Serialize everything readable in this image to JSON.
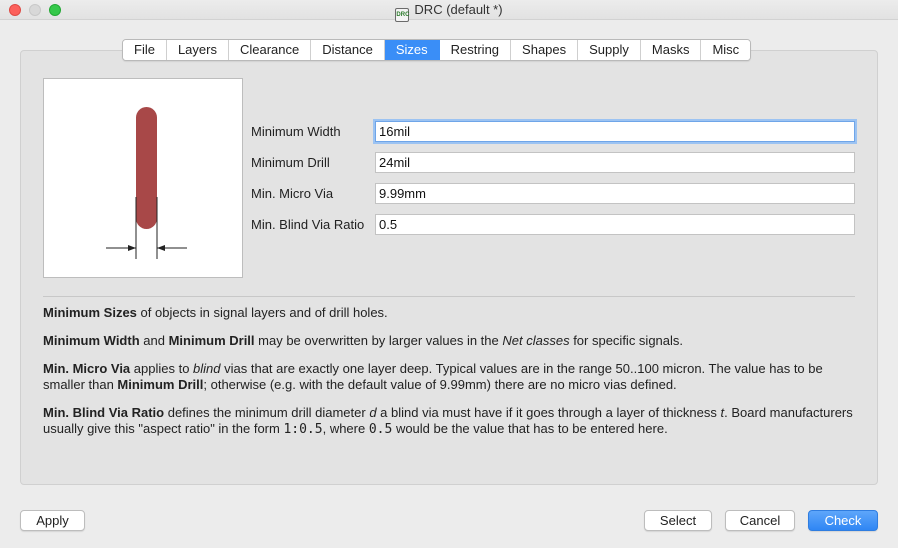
{
  "window": {
    "title": "DRC (default *)",
    "app_icon_text": "DRC"
  },
  "tabs": [
    {
      "label": "File"
    },
    {
      "label": "Layers"
    },
    {
      "label": "Clearance"
    },
    {
      "label": "Distance"
    },
    {
      "label": "Sizes",
      "active": true
    },
    {
      "label": "Restring"
    },
    {
      "label": "Shapes"
    },
    {
      "label": "Supply"
    },
    {
      "label": "Masks"
    },
    {
      "label": "Misc"
    }
  ],
  "form": {
    "min_width": {
      "label": "Minimum Width",
      "value": "16mil"
    },
    "min_drill": {
      "label": "Minimum Drill",
      "value": "24mil"
    },
    "min_micro_via": {
      "label": "Min. Micro Via",
      "value": "9.99mm"
    },
    "min_blind_via_ratio": {
      "label": "Min. Blind Via Ratio",
      "value": "0.5"
    }
  },
  "description": {
    "p1": {
      "b1": "Minimum Sizes",
      "t1": " of objects in signal layers and of drill holes."
    },
    "p2": {
      "b1": "Minimum Width",
      "t1": " and ",
      "b2": "Minimum Drill",
      "t2": " may be overwritten by larger values in the ",
      "i1": "Net classes",
      "t3": " for specific signals."
    },
    "p3": {
      "b1": "Min. Micro Via",
      "t1": " applies to ",
      "i1": "blind",
      "t2": " vias that are exactly one layer deep. Typical values are in the range 50..100 micron. The value has to be smaller than ",
      "b2": "Minimum Drill",
      "t3": "; otherwise (e.g. with the default value of 9.99mm) there are no micro vias defined."
    },
    "p4": {
      "b1": "Min. Blind Via Ratio",
      "t1": " defines the minimum drill diameter ",
      "i1": "d",
      "t2": " a blind via must have if it goes through a layer of thickness ",
      "i2": "t",
      "t3": ". Board manufacturers usually give this \"aspect ratio\" in the form ",
      "m1": "1:0.5",
      "t4": ", where ",
      "m2": "0.5",
      "t5": " would be the value that has to be entered here."
    }
  },
  "buttons": {
    "apply": "Apply",
    "select": "Select",
    "cancel": "Cancel",
    "check": "Check"
  },
  "colors": {
    "accent": "#3a8ef7",
    "trace": "#a84848"
  },
  "icons": {
    "close": "close-icon",
    "minimize": "minimize-icon",
    "maximize": "maximize-icon"
  }
}
